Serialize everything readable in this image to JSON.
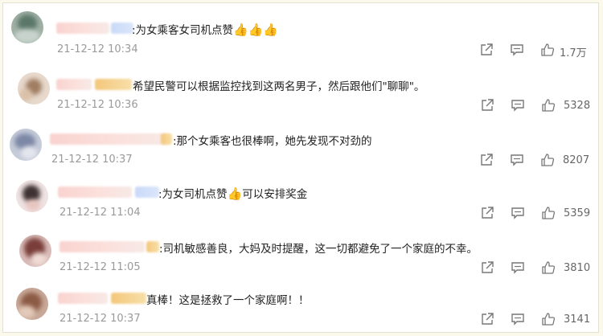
{
  "comments": [
    {
      "text": ":为女乘客女司机点赞",
      "thumbs": "👍👍👍",
      "time": "21-12-12 10:34",
      "likes": "1.7万"
    },
    {
      "text": "希望民警可以根据监控找到这两名男子，然后跟他们\"聊聊\"。",
      "thumbs": "",
      "time": "21-12-12 10:36",
      "likes": "5328"
    },
    {
      "text": ":那个女乘客也很棒啊，她先发现不对劲的",
      "thumbs": "",
      "time": "21-12-12 10:37",
      "likes": "8207"
    },
    {
      "text": ":为女司机点赞",
      "thumbs": "👍",
      "text2": "可以安排奖金",
      "time": "21-12-12 11:04",
      "likes": "5359"
    },
    {
      "text": ":司机敏感善良，大妈及时提醒，这一切都避免了一个家庭的不幸。",
      "thumbs": "",
      "time": "21-12-12 11:05",
      "likes": "3810"
    },
    {
      "text": "真棒！这是拯救了一个家庭啊！！",
      "thumbs": "",
      "time": "21-12-12 10:37",
      "likes": "3141"
    }
  ],
  "icons": {
    "share": "share-icon",
    "comment": "comment-icon",
    "like": "like-icon"
  },
  "colors": {
    "background": "#fbf8ec",
    "card": "#ffffff",
    "time": "#9a9a9a",
    "thumb": "#e0a84a"
  }
}
